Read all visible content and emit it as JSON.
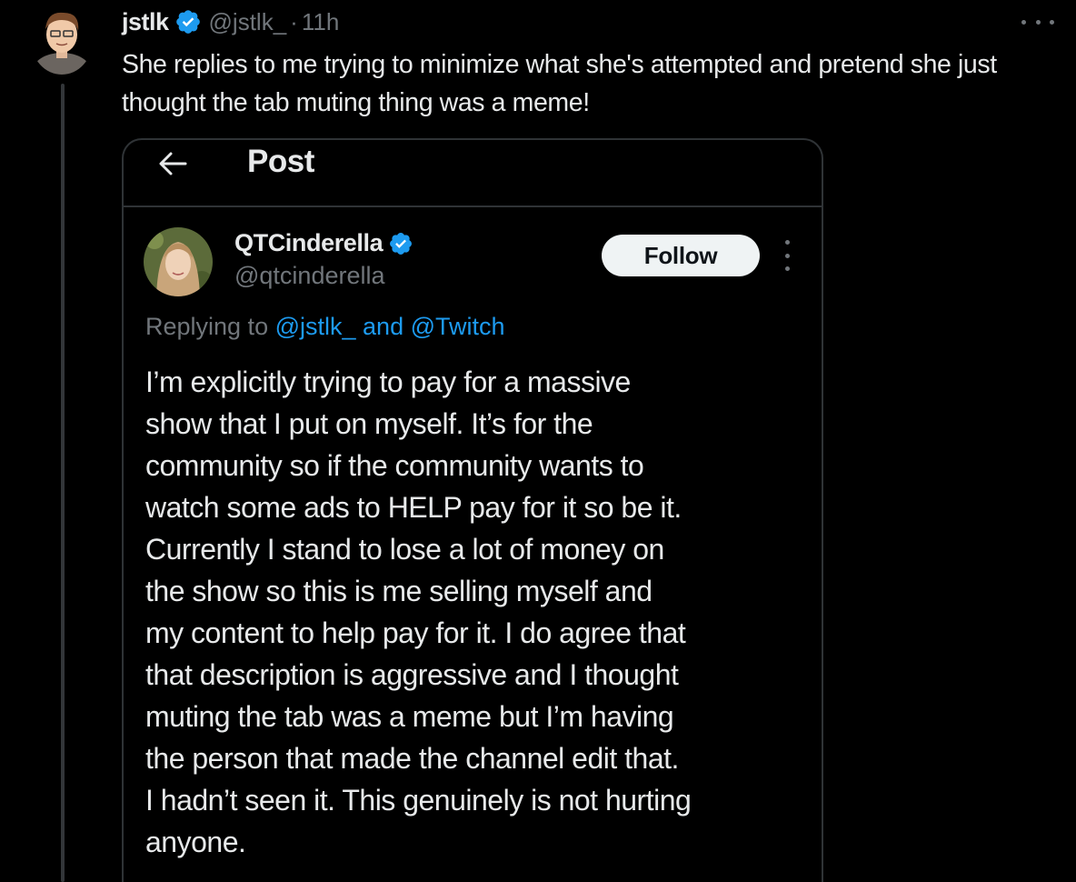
{
  "tweet": {
    "author_name": "jstlk",
    "author_handle": "@jstlk_",
    "separator": "·",
    "time": "11h",
    "text": "She replies to me trying to minimize what she's attempted and pretend she just thought the tab muting thing was a meme!",
    "more_icon": "more-horizontal-icon"
  },
  "card": {
    "title": "Post",
    "back_icon": "arrow-left-icon",
    "author_name": "QTCinderella",
    "author_handle": "@qtcinderella",
    "follow_label": "Follow",
    "replying_prefix": "Replying to",
    "replying_mentions": "@jstlk_ and @Twitch",
    "body_lines": [
      "I’m explicitly trying to pay for a massive",
      "show that I put on myself. It’s for the",
      "community so if the community wants to",
      "watch some ads to HELP pay for it so be it.",
      "Currently I stand to lose a lot of money on",
      "the show so this is me selling myself and",
      "my content to help pay for it. I do agree that",
      "that description is aggressive and I thought",
      "muting the tab was a meme but I’m having",
      "the person that made the channel edit that.",
      "I hadn’t seen it. This genuinely is not hurting",
      "anyone."
    ]
  },
  "colors": {
    "background": "#000000",
    "text": "#e7e9ea",
    "secondary": "#71767b",
    "accent": "#1d9bf0",
    "border": "#2f3336"
  }
}
